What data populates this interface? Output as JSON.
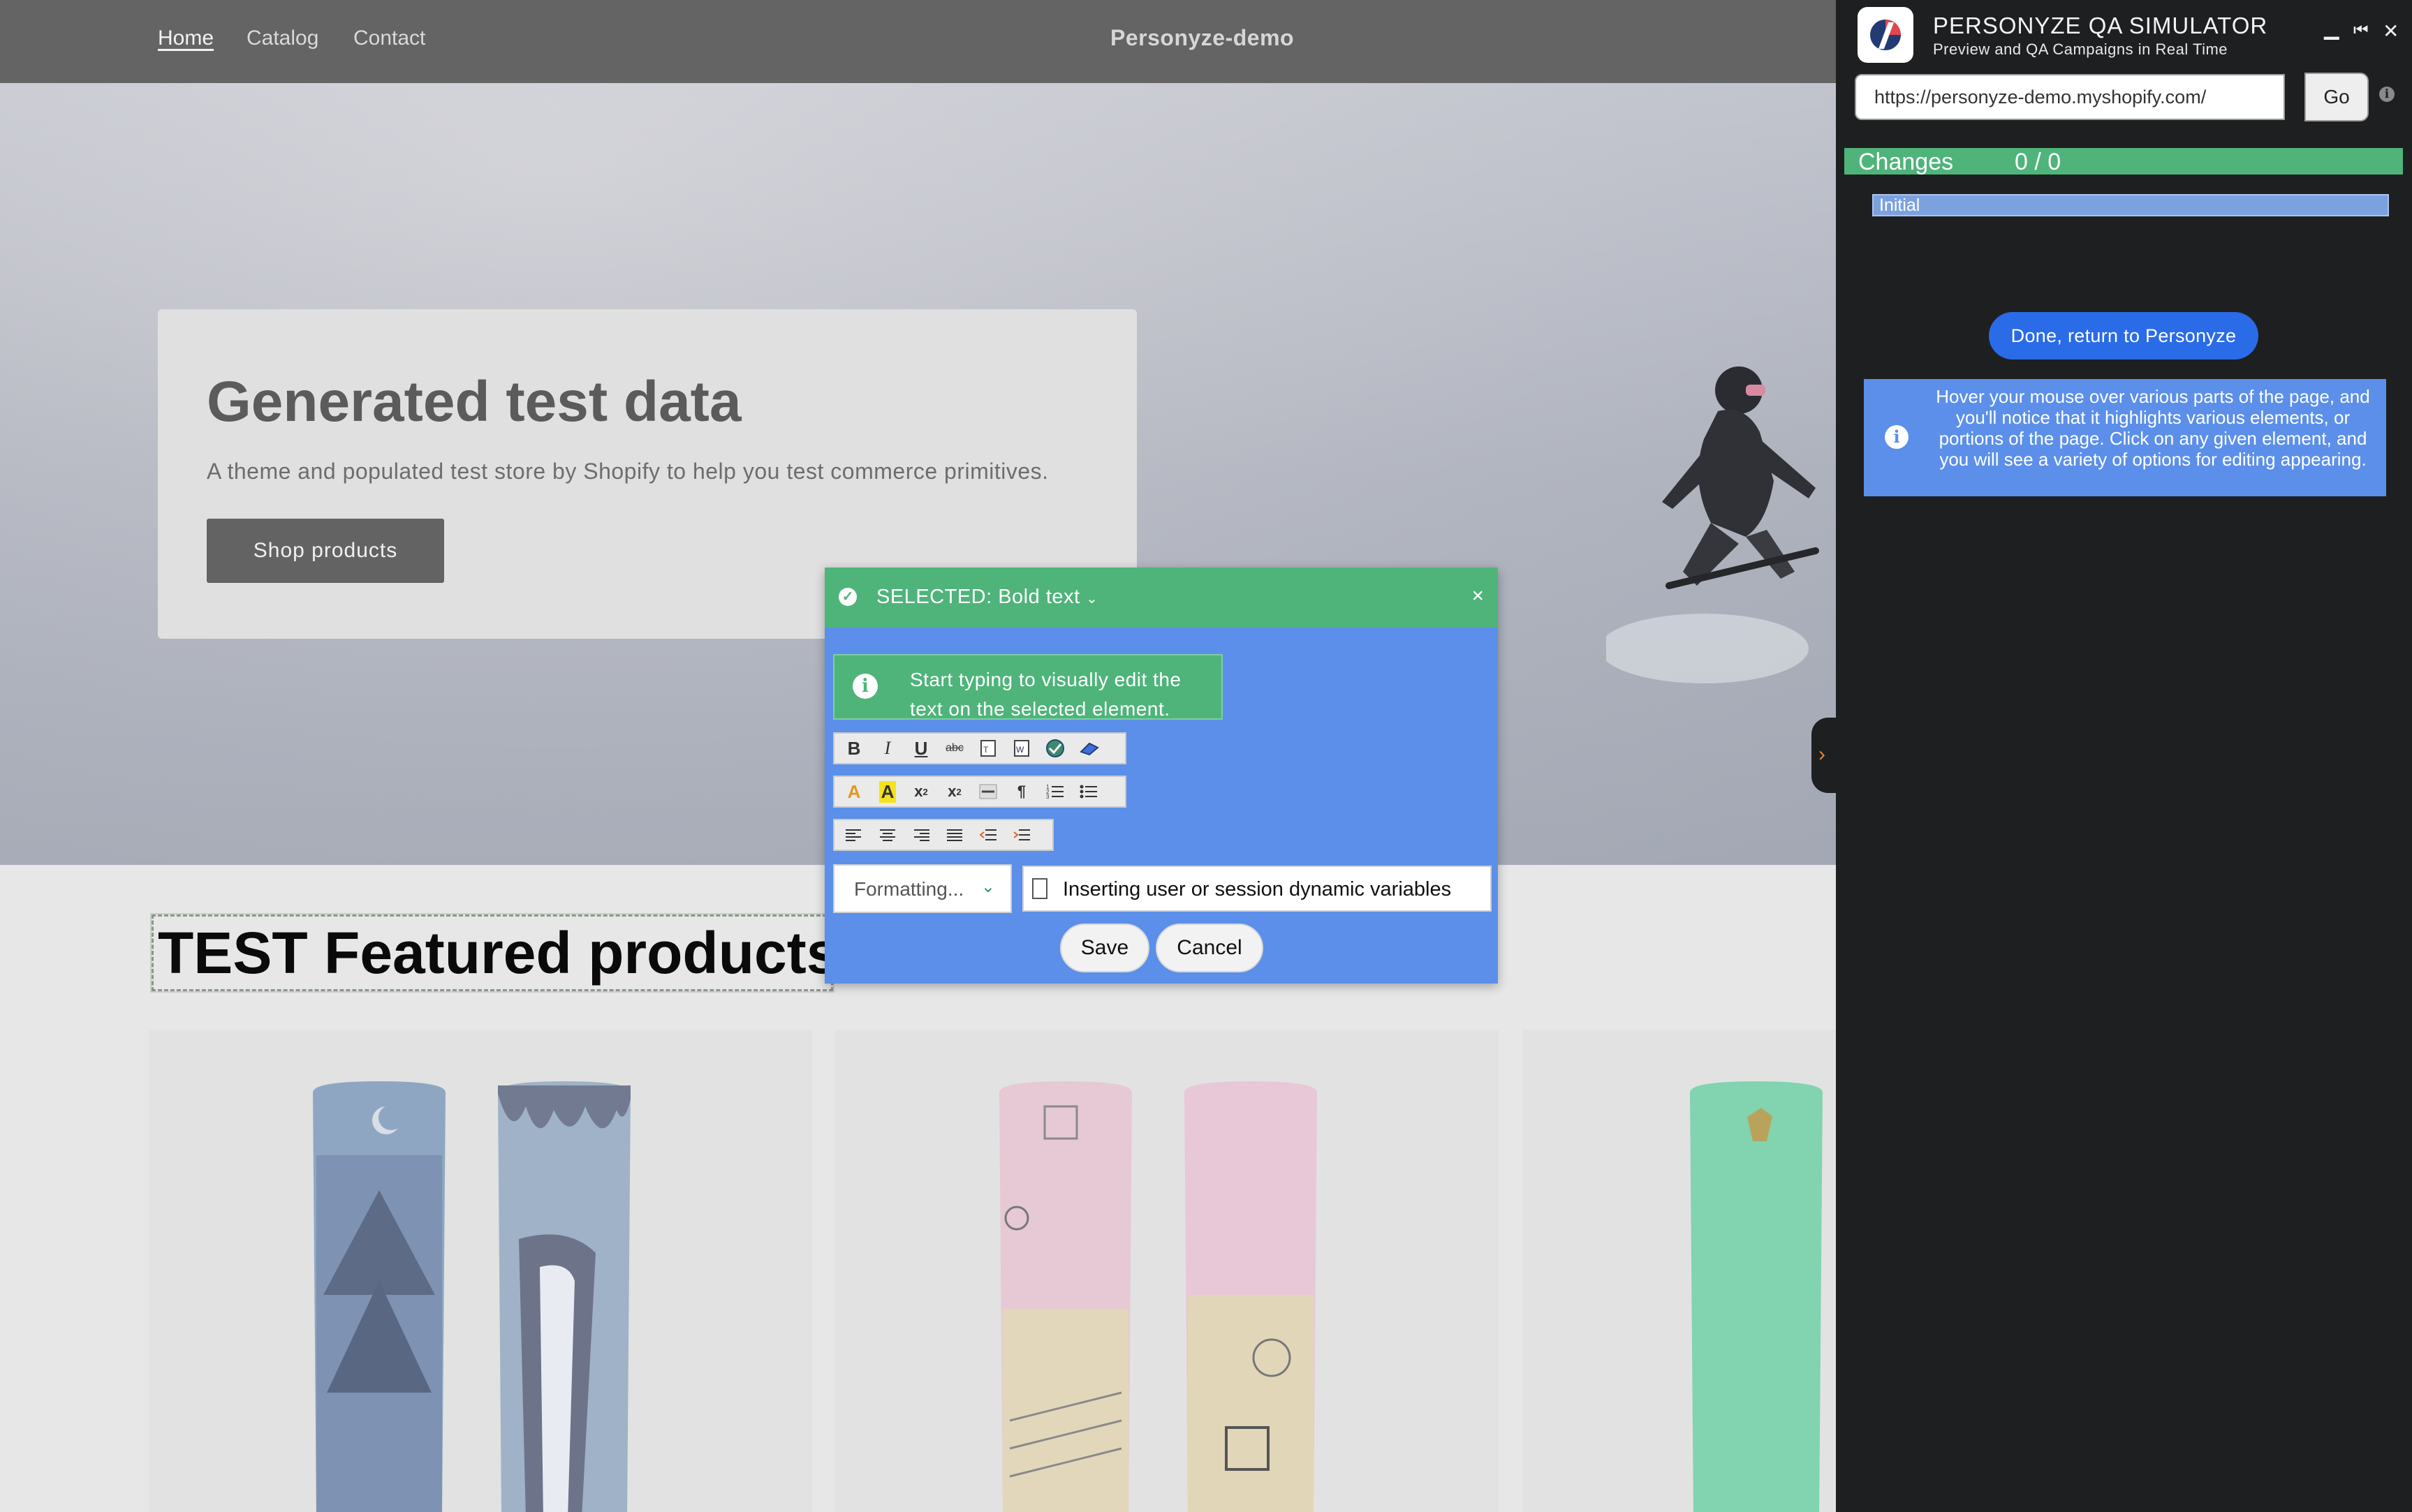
{
  "store": {
    "nav": {
      "home": "Home",
      "catalog": "Catalog",
      "contact": "Contact"
    },
    "title": "Personyze-demo",
    "hero": {
      "heading": "Generated test data",
      "subtext": "A theme and populated test store by Shopify to help you test commerce primitives.",
      "button": "Shop products"
    },
    "featured_heading": "TEST Featured products"
  },
  "editor_popup": {
    "title": "SELECTED: Bold text",
    "close": "×",
    "hint": "Start typing to visually edit the text on the selected element.",
    "formatting_label": "Formatting...",
    "variables_button": "Inserting user or session dynamic variables",
    "save": "Save",
    "cancel": "Cancel",
    "toolbar_row1": [
      "bold-icon",
      "italic-icon",
      "underline-icon",
      "strikethrough-icon",
      "paste-text-icon",
      "paste-word-icon",
      "spellcheck-icon",
      "eraser-icon"
    ],
    "toolbar_row2": [
      "text-color-icon",
      "highlight-icon",
      "subscript-icon",
      "superscript-icon",
      "horizontal-rule-icon",
      "paragraph-icon",
      "ordered-list-icon",
      "bullet-list-icon"
    ],
    "toolbar_row3": [
      "align-left-icon",
      "align-center-icon",
      "align-right-icon",
      "align-justify-icon",
      "outdent-icon",
      "indent-icon"
    ]
  },
  "simulator": {
    "title": "PERSONYZE QA SIMULATOR",
    "subtitle": "Preview and QA Campaigns in Real Time",
    "url_value": "https://personyze-demo.myshopify.com/",
    "go": "Go",
    "changes_label": "Changes",
    "changes_count": "0 / 0",
    "initial": "Initial",
    "done_button": "Done, return to Personyze",
    "info": "Hover your mouse over various parts of the page, and you'll notice that it highlights various elements, or portions of the page. Click on any given element, and you will see a variety of options for editing appearing.",
    "colors": {
      "accent_green": "#4fb47a",
      "accent_blue": "#5b8fe9",
      "button_blue": "#2a6be8",
      "panel_bg": "#1e1f20"
    }
  }
}
